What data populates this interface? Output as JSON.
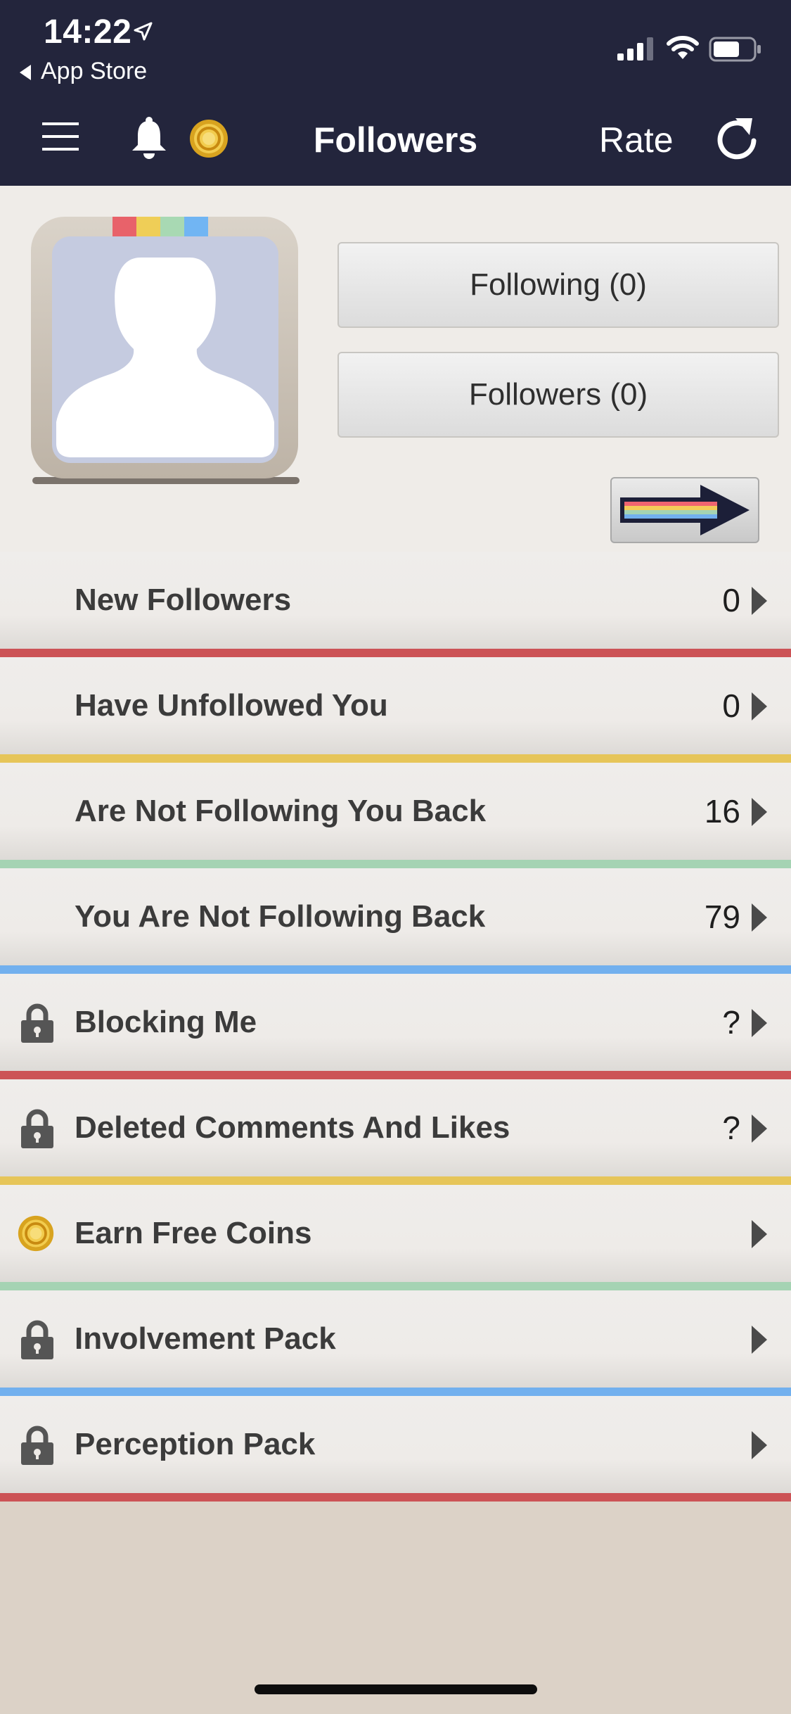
{
  "status_bar": {
    "time": "14:22",
    "back_app": "App Store"
  },
  "nav": {
    "title": "Followers",
    "rate_label": "Rate"
  },
  "profile": {
    "following_button": "Following (0)",
    "followers_button": "Followers (0)"
  },
  "list": {
    "items": [
      {
        "label": "New Followers",
        "value": "0",
        "icon": "",
        "stripe": "#cc5356"
      },
      {
        "label": "Have Unfollowed You",
        "value": "0",
        "icon": "",
        "stripe": "#e6c559"
      },
      {
        "label": "Are Not Following You Back",
        "value": "16",
        "icon": "",
        "stripe": "#a5d3b3"
      },
      {
        "label": "You Are Not Following Back",
        "value": "79",
        "icon": "",
        "stripe": "#72b0ee"
      },
      {
        "label": "Blocking Me",
        "value": "?",
        "icon": "lock-icon",
        "stripe": "#cc5356"
      },
      {
        "label": "Deleted Comments And Likes",
        "value": "?",
        "icon": "lock-icon",
        "stripe": "#e6c559"
      },
      {
        "label": "Earn Free Coins",
        "value": "",
        "icon": "coin-icon",
        "stripe": "#a5d3b3"
      },
      {
        "label": "Involvement Pack",
        "value": "",
        "icon": "lock-icon",
        "stripe": "#72b0ee"
      },
      {
        "label": "Perception Pack",
        "value": "",
        "icon": "lock-icon",
        "stripe": "#cc5356"
      }
    ]
  },
  "colors": {
    "nav_background": "#23253c",
    "red": "#cc5356",
    "yellow": "#e6c559",
    "green": "#a5d3b3",
    "blue": "#72b0ee"
  }
}
